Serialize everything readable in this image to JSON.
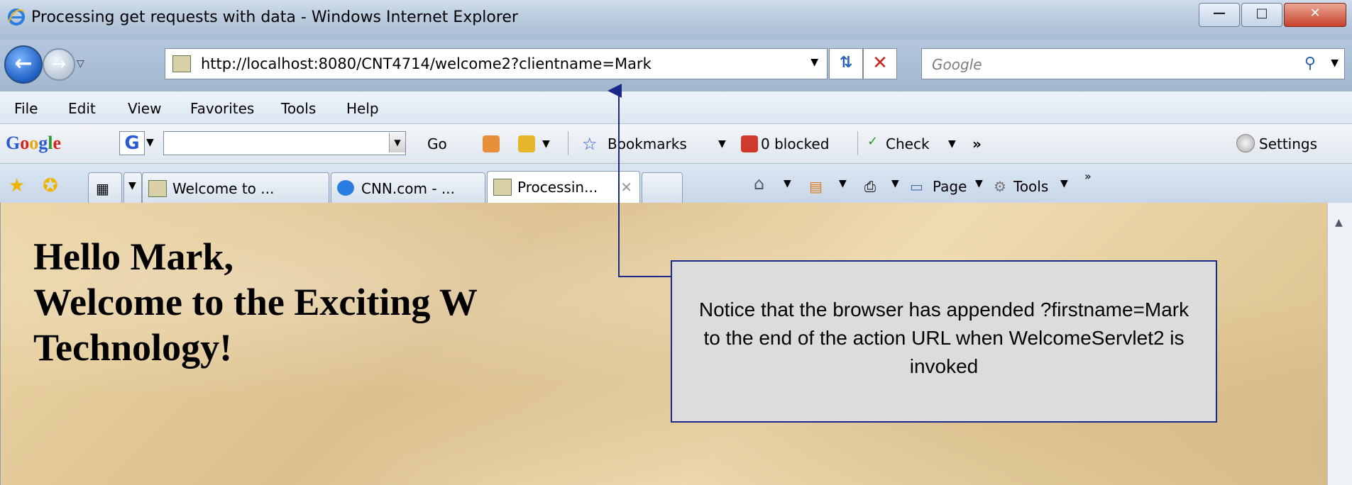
{
  "window": {
    "title": "Processing get requests with data - Windows Internet Explorer",
    "icon": "ie-logo-icon"
  },
  "navigation": {
    "address": "http://localhost:8080/CNT4714/welcome2?clientname=Mark",
    "search_placeholder": "Google"
  },
  "menu": {
    "items": [
      "File",
      "Edit",
      "View",
      "Favorites",
      "Tools",
      "Help"
    ]
  },
  "google_toolbar": {
    "logo": "Google",
    "go_label": "Go",
    "bookmarks_label": "Bookmarks",
    "blocked_label": "0 blocked",
    "check_label": "Check",
    "more_label": "»",
    "settings_label": "Settings"
  },
  "tabs": [
    {
      "label": "Welcome to ...",
      "active": false
    },
    {
      "label": "CNN.com - ...",
      "active": false
    },
    {
      "label": "Processin...",
      "active": true
    }
  ],
  "tab_tools": {
    "page_label": "Page",
    "tools_label": "Tools"
  },
  "content": {
    "heading_line1": "Hello Mark,",
    "heading_line2": "Welcome to the Exciting W",
    "heading_line3": "Technology!"
  },
  "callout": {
    "text": "Notice that the browser has appended ?firstname=Mark to the end of the action URL when WelcomeServlet2 is invoked"
  },
  "colors": {
    "callout_border": "#1a2a8a",
    "arrow": "#1a2a8a",
    "content_background": "#e6cd9a"
  }
}
